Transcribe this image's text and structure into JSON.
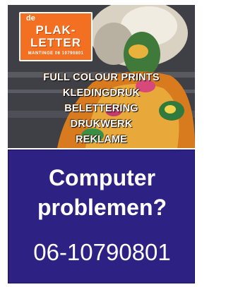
{
  "logo": {
    "prefix": "de",
    "line1": "PLAK-",
    "line2": "LETTER",
    "address": "MANTINGE   06 10790801"
  },
  "services": [
    "FULL COLOUR PRINTS",
    "KLEDINGDRUK",
    "BELETTERING",
    "DRUKWERK",
    "REKLAME"
  ],
  "panel": {
    "headline_line1": "Computer",
    "headline_line2": "problemen?",
    "phone": "06-10790801"
  },
  "colors": {
    "logo_bg": "#f36f21",
    "panel_bg": "#2d2283",
    "text": "#ffffff"
  }
}
